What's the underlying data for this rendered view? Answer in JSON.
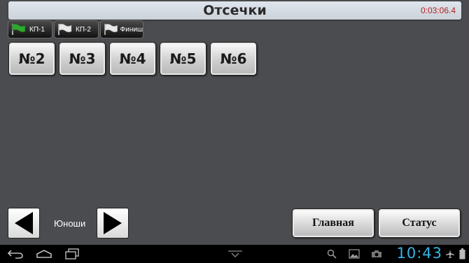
{
  "header": {
    "title": "Отсечки",
    "timer": "0:03:06.4"
  },
  "checkpoints": [
    {
      "label": "КП-1",
      "flag_color": "#2ea82e"
    },
    {
      "label": "КП-2",
      "flag_color": "#e8e8e8"
    },
    {
      "label": "Финиш",
      "flag_color": "#e8e8e8"
    }
  ],
  "numbers": [
    "№2",
    "№3",
    "№4",
    "№5",
    "№6"
  ],
  "group": {
    "label": "Юноши"
  },
  "buttons": {
    "main": "Главная",
    "status": "Статус"
  },
  "statusbar": {
    "time": "10:43"
  },
  "colors": {
    "accent_clock": "#33b5e5",
    "timer": "#b22222"
  }
}
